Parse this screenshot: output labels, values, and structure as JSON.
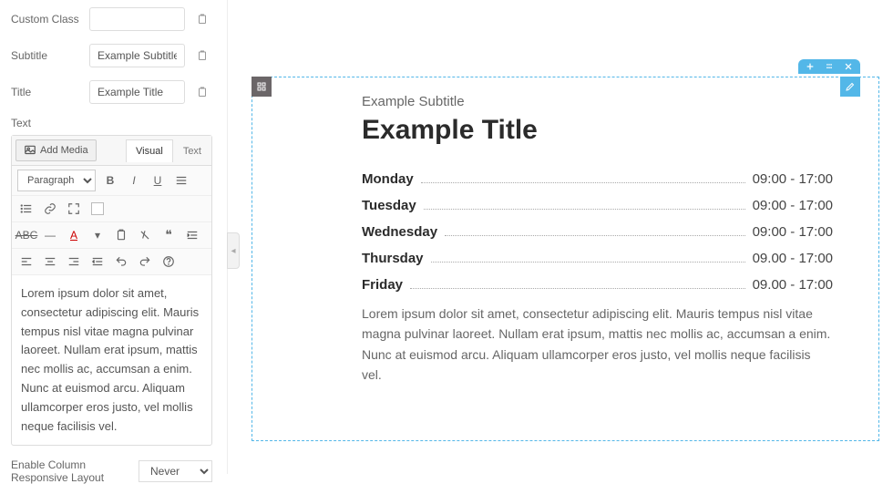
{
  "fields": {
    "custom_class": {
      "label": "Custom Class",
      "value": ""
    },
    "subtitle": {
      "label": "Subtitle",
      "value": "Example Subtitle"
    },
    "title": {
      "label": "Title",
      "value": "Example Title"
    },
    "text_label": "Text"
  },
  "editor": {
    "add_media_label": "Add Media",
    "tabs": {
      "visual": "Visual",
      "text": "Text"
    },
    "format_select": "Paragraph",
    "content": "Lorem ipsum dolor sit amet, consectetur adipiscing elit. Mauris tempus nisl vitae magna pulvinar laoreet. Nullam erat ipsum, mattis nec mollis ac, accumsan a enim. Nunc at euismod arcu. Aliquam ullamcorper eros justo, vel mollis neque facilisis vel."
  },
  "responsive": {
    "label": "Enable Column Responsive Layout",
    "value": "Never"
  },
  "preview": {
    "subtitle": "Example Subtitle",
    "title": "Example Title",
    "days": [
      {
        "name": "Monday",
        "hours": "09:00 - 17:00"
      },
      {
        "name": "Tuesday",
        "hours": "09:00 - 17:00"
      },
      {
        "name": "Wednesday",
        "hours": "09:00 - 17:00"
      },
      {
        "name": "Thursday",
        "hours": "09.00 - 17:00"
      },
      {
        "name": "Friday",
        "hours": "09.00 - 17:00"
      }
    ],
    "body": "Lorem ipsum dolor sit amet, consectetur adipiscing elit. Mauris tempus nisl vitae magna pulvinar laoreet. Nullam erat ipsum, mattis nec mollis ac, accumsan a enim. Nunc at euismod arcu. Aliquam ullamcorper eros justo, vel mollis neque facilisis vel."
  },
  "colors": {
    "accent": "#53b7e8"
  }
}
